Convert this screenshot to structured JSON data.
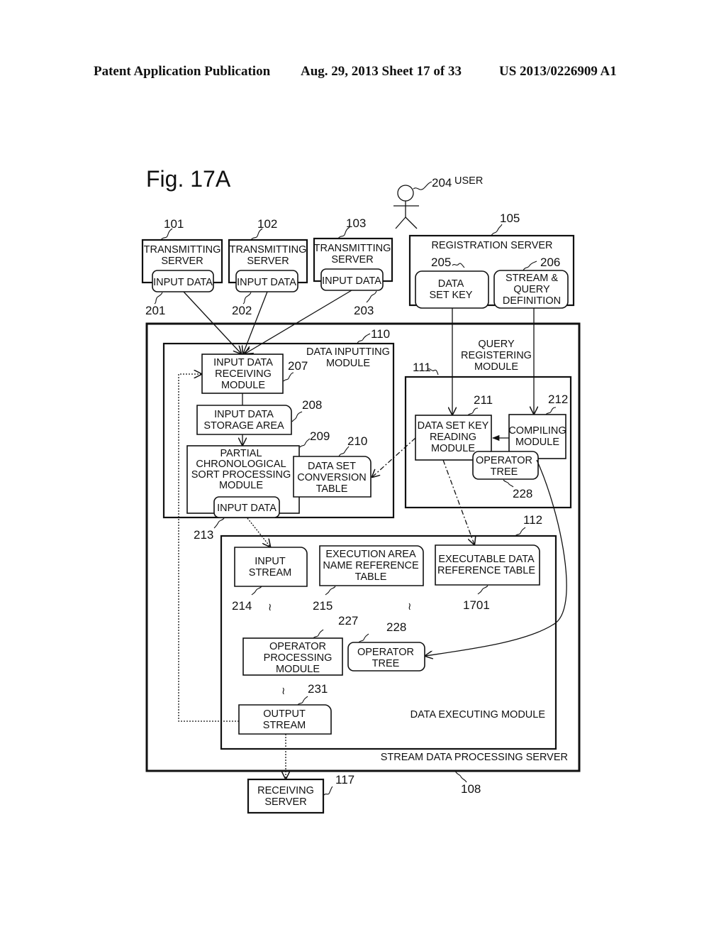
{
  "header": {
    "publication": "Patent Application Publication",
    "date_sheet": "Aug. 29, 2013  Sheet 17 of 33",
    "number": "US 2013/0226909 A1"
  },
  "figure": {
    "title": "Fig. 17A",
    "user": {
      "ref": "204",
      "label": "USER"
    },
    "transmitting_servers": [
      {
        "ref": "101",
        "line1": "TRANSMITTING",
        "line2": "SERVER",
        "input_label": "INPUT DATA",
        "input_ref": "201"
      },
      {
        "ref": "102",
        "line1": "TRANSMITTING",
        "line2": "SERVER",
        "input_label": "INPUT DATA",
        "input_ref": "202"
      },
      {
        "ref": "103",
        "line1": "TRANSMITTING",
        "line2": "SERVER",
        "input_label": "INPUT DATA",
        "input_ref": "203"
      }
    ],
    "registration_server": {
      "ref": "105",
      "label": "REGISTRATION SERVER",
      "data_set_key": {
        "ref": "205",
        "line1": "DATA",
        "line2": "SET KEY"
      },
      "stream_query": {
        "ref": "206",
        "line1": "STREAM &",
        "line2": "QUERY",
        "line3": "DEFINITION"
      }
    },
    "stream_server": {
      "ref": "108",
      "label": "STREAM DATA PROCESSING SERVER"
    },
    "data_inputting_module": {
      "ref": "110",
      "line1": "DATA INPUTTING",
      "line2": "MODULE",
      "receiving": {
        "ref": "207",
        "line1": "INPUT DATA",
        "line2": "RECEIVING",
        "line3": "MODULE"
      },
      "storage": {
        "ref": "208",
        "line1": "INPUT DATA",
        "line2": "STORAGE AREA"
      },
      "sort": {
        "ref": "209",
        "line1": "PARTIAL",
        "line2": "CHRONOLOGICAL",
        "line3": "SORT PROCESSING",
        "line4": "MODULE"
      },
      "conversion": {
        "ref": "210",
        "line1": "DATA SET",
        "line2": "CONVERSION",
        "line3": "TABLE"
      },
      "input_data": {
        "ref": "213",
        "label": "INPUT DATA"
      }
    },
    "query_registering_module": {
      "ref": "111",
      "line1": "QUERY",
      "line2": "REGISTERING",
      "line3": "MODULE",
      "reader": {
        "ref": "211",
        "line1": "DATA SET KEY",
        "line2": "READING",
        "line3": "MODULE"
      },
      "compiler": {
        "ref": "212",
        "line1": "COMPILING",
        "line2": "MODULE"
      },
      "operator_tree": {
        "ref": "228",
        "line1": "OPERATOR",
        "line2": "TREE"
      }
    },
    "data_executing_module": {
      "ref": "112",
      "label": "DATA EXECUTING MODULE",
      "input_stream": {
        "ref": "214",
        "line1": "INPUT",
        "line2": "STREAM"
      },
      "exec_area": {
        "ref": "215",
        "line1": "EXECUTION AREA",
        "line2": "NAME REFERENCE",
        "line3": "TABLE"
      },
      "exec_data": {
        "ref": "1701",
        "line1": "EXECUTABLE DATA",
        "line2": "REFERENCE TABLE"
      },
      "operator_processing": {
        "ref": "227",
        "line1": "OPERATOR",
        "line2": "PROCESSING",
        "line3": "MODULE"
      },
      "operator_tree": {
        "ref": "228",
        "line1": "OPERATOR",
        "line2": "TREE"
      },
      "output_stream": {
        "ref": "231",
        "line1": "OUTPUT",
        "line2": "STREAM"
      },
      "ellipsis": "≀"
    },
    "receiving_server": {
      "ref": "117",
      "line1": "RECEIVING",
      "line2": "SERVER"
    }
  }
}
